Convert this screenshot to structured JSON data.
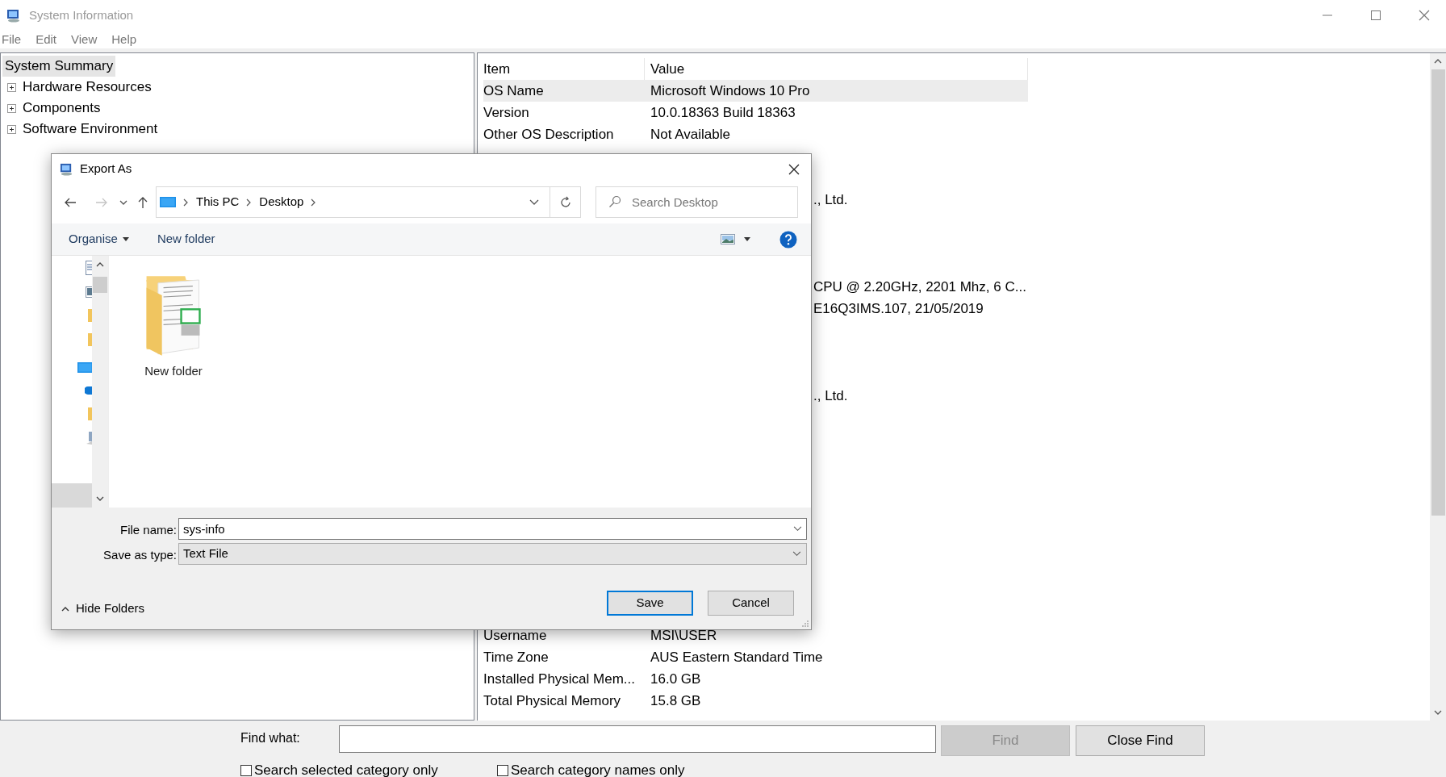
{
  "window": {
    "title": "System Information"
  },
  "menu": [
    "File",
    "Edit",
    "View",
    "Help"
  ],
  "tree": {
    "items": [
      {
        "label": "System Summary",
        "selected": true,
        "children": [
          {
            "label": "Hardware Resources",
            "selected": false,
            "expanded": false
          },
          {
            "label": "Components",
            "selected": false,
            "expanded": false
          },
          {
            "label": "Software Environment",
            "selected": false,
            "expanded": false
          }
        ]
      }
    ]
  },
  "table": {
    "columns": [
      "Item",
      "Value"
    ],
    "rows": [
      {
        "item": "OS Name",
        "value": "Microsoft Windows 10 Pro",
        "selected": true
      },
      {
        "item": "Version",
        "value": "10.0.18363 Build 18363",
        "selected": false
      },
      {
        "item": "Other OS Description",
        "value": "Not Available",
        "selected": false
      }
    ],
    "value_fragments": [
      "., Ltd.",
      "CPU @ 2.20GHz, 2201 Mhz, 6 C...",
      "E16Q3IMS.107, 21/05/2019",
      "., Ltd."
    ],
    "rows_lower": [
      {
        "item": "Username",
        "value": "MSI\\USER",
        "selected": false
      },
      {
        "item": "Time Zone",
        "value": "AUS Eastern Standard Time",
        "selected": false
      },
      {
        "item": "Installed Physical Mem...",
        "value": "16.0 GB",
        "selected": false
      },
      {
        "item": "Total Physical Memory",
        "value": "15.8 GB",
        "selected": false
      }
    ]
  },
  "dialog": {
    "title": "Export As",
    "breadcrumb": [
      "This PC",
      "Desktop"
    ],
    "search_placeholder": "Search Desktop",
    "organise": "Organise",
    "new_folder": "New folder",
    "files": [
      {
        "name": "New folder"
      }
    ],
    "file_name_label": "File name:",
    "file_name": "sys-info",
    "save_type_label": "Save as type:",
    "save_type": "Text File",
    "hide_folders": "Hide Folders",
    "buttons": [
      {
        "label": "Save",
        "default": true
      },
      {
        "label": "Cancel",
        "default": false
      }
    ]
  },
  "find_bar": {
    "label": "Find what:",
    "buttons": [
      {
        "label": "Find",
        "disabled": true
      },
      {
        "label": "Close Find",
        "disabled": false
      }
    ],
    "checkboxes": [
      {
        "label": "Search selected category only",
        "checked": false
      },
      {
        "label": "Search category names only",
        "checked": false
      }
    ]
  }
}
